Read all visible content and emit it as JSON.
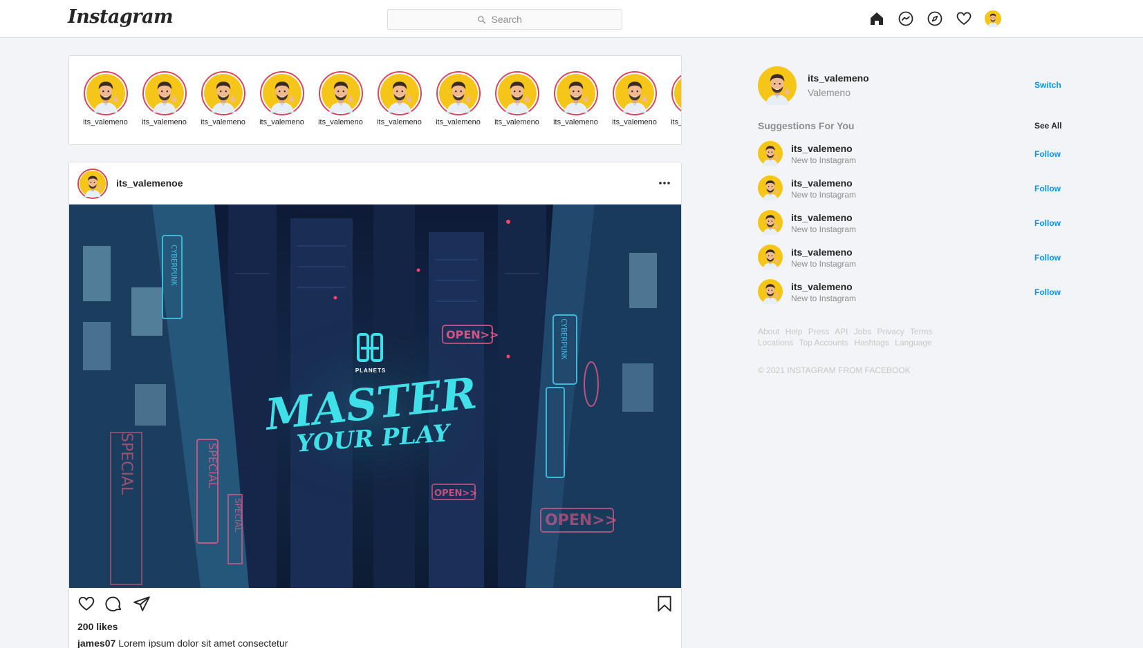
{
  "header": {
    "logo": "Instagram",
    "search_placeholder": "Search"
  },
  "stories": [
    {
      "username": "its_valemeno"
    },
    {
      "username": "its_valemeno"
    },
    {
      "username": "its_valemeno"
    },
    {
      "username": "its_valemeno"
    },
    {
      "username": "its_valemeno"
    },
    {
      "username": "its_valemeno"
    },
    {
      "username": "its_valemeno"
    },
    {
      "username": "its_valemeno"
    },
    {
      "username": "its_valemeno"
    },
    {
      "username": "its_valemeno"
    },
    {
      "username": "its_valemeno"
    }
  ],
  "post": {
    "username": "its_valemenoe",
    "image": {
      "brand": "PLANETS",
      "headline_1": "MASTER",
      "headline_2": "YOUR PLAY",
      "signs": [
        "CYBERPUNK",
        "OPEN>>",
        "SPECIAL",
        "SPECIAL",
        "OPEN>>",
        "OPEN>>",
        "CYBERPUNK",
        "SPECIAL"
      ]
    },
    "likes": "200 likes",
    "caption_user": "james07",
    "caption_text": "Lorem ipsum dolor sit amet consectetur"
  },
  "sidebar": {
    "me": {
      "username": "its_valemeno",
      "name": "Valemeno",
      "switch_label": "Switch"
    },
    "suggestions_title": "Suggestions For You",
    "see_all": "See All",
    "suggestions": [
      {
        "username": "its_valemeno",
        "subtitle": "New to Instagram",
        "action": "Follow"
      },
      {
        "username": "its_valemeno",
        "subtitle": "New to Instagram",
        "action": "Follow"
      },
      {
        "username": "its_valemeno",
        "subtitle": "New to Instagram",
        "action": "Follow"
      },
      {
        "username": "its_valemeno",
        "subtitle": "New to Instagram",
        "action": "Follow"
      },
      {
        "username": "its_valemeno",
        "subtitle": "New to Instagram",
        "action": "Follow"
      }
    ],
    "footer_links": [
      "About",
      "Help",
      "Press",
      "API",
      "Jobs",
      "Privacy",
      "Terms",
      "Locations",
      "Top Accounts",
      "Hashtags",
      "Language"
    ],
    "copyright": "© 2021 INSTAGRAM FROM FACEBOOK"
  },
  "colors": {
    "accent": "#0095f6",
    "story_ring": "#d9455b",
    "avatar_bg": "#f5c518",
    "neon": "#3fe0e8"
  },
  "icons": {
    "nav": [
      "home-icon",
      "messenger-icon",
      "explore-icon",
      "heart-icon",
      "profile-avatar"
    ],
    "post_actions": [
      "like-heart-icon",
      "comment-icon",
      "share-icon",
      "bookmark-icon"
    ]
  }
}
